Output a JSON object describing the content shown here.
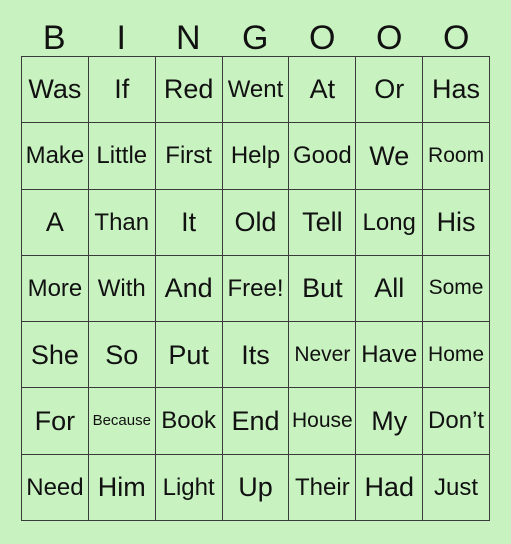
{
  "card": {
    "title": "Bingo Card",
    "background_color": "#c8f2c0",
    "border_color": "#3a3a3a",
    "text_color": "#111111",
    "columns": 7,
    "rows": 7
  },
  "header": {
    "letters": [
      "B",
      "I",
      "N",
      "G",
      "O",
      "O",
      "O"
    ]
  },
  "grid": {
    "rows": [
      [
        {
          "text": "Was",
          "size": "lg"
        },
        {
          "text": "If",
          "size": "lg"
        },
        {
          "text": "Red",
          "size": "lg"
        },
        {
          "text": "Went",
          "size": "md"
        },
        {
          "text": "At",
          "size": "lg"
        },
        {
          "text": "Or",
          "size": "lg"
        },
        {
          "text": "Has",
          "size": "lg"
        }
      ],
      [
        {
          "text": "Make",
          "size": "md"
        },
        {
          "text": "Little",
          "size": "md"
        },
        {
          "text": "First",
          "size": "md"
        },
        {
          "text": "Help",
          "size": "md"
        },
        {
          "text": "Good",
          "size": "md"
        },
        {
          "text": "We",
          "size": "lg"
        },
        {
          "text": "Room",
          "size": "sm"
        }
      ],
      [
        {
          "text": "A",
          "size": "lg"
        },
        {
          "text": "Than",
          "size": "md"
        },
        {
          "text": "It",
          "size": "lg"
        },
        {
          "text": "Old",
          "size": "lg"
        },
        {
          "text": "Tell",
          "size": "lg"
        },
        {
          "text": "Long",
          "size": "md"
        },
        {
          "text": "His",
          "size": "lg"
        }
      ],
      [
        {
          "text": "More",
          "size": "md"
        },
        {
          "text": "With",
          "size": "md"
        },
        {
          "text": "And",
          "size": "lg"
        },
        {
          "text": "Free!",
          "size": "md"
        },
        {
          "text": "But",
          "size": "lg"
        },
        {
          "text": "All",
          "size": "lg"
        },
        {
          "text": "Some",
          "size": "sm"
        }
      ],
      [
        {
          "text": "She",
          "size": "lg"
        },
        {
          "text": "So",
          "size": "lg"
        },
        {
          "text": "Put",
          "size": "lg"
        },
        {
          "text": "Its",
          "size": "lg"
        },
        {
          "text": "Never",
          "size": "sm"
        },
        {
          "text": "Have",
          "size": "md"
        },
        {
          "text": "Home",
          "size": "sm"
        }
      ],
      [
        {
          "text": "For",
          "size": "lg"
        },
        {
          "text": "Because",
          "size": "xs"
        },
        {
          "text": "Book",
          "size": "md"
        },
        {
          "text": "End",
          "size": "lg"
        },
        {
          "text": "House",
          "size": "sm"
        },
        {
          "text": "My",
          "size": "lg"
        },
        {
          "text": "Don’t",
          "size": "md"
        }
      ],
      [
        {
          "text": "Need",
          "size": "md"
        },
        {
          "text": "Him",
          "size": "lg"
        },
        {
          "text": "Light",
          "size": "md"
        },
        {
          "text": "Up",
          "size": "lg"
        },
        {
          "text": "Their",
          "size": "md"
        },
        {
          "text": "Had",
          "size": "lg"
        },
        {
          "text": "Just",
          "size": "md"
        }
      ]
    ]
  }
}
